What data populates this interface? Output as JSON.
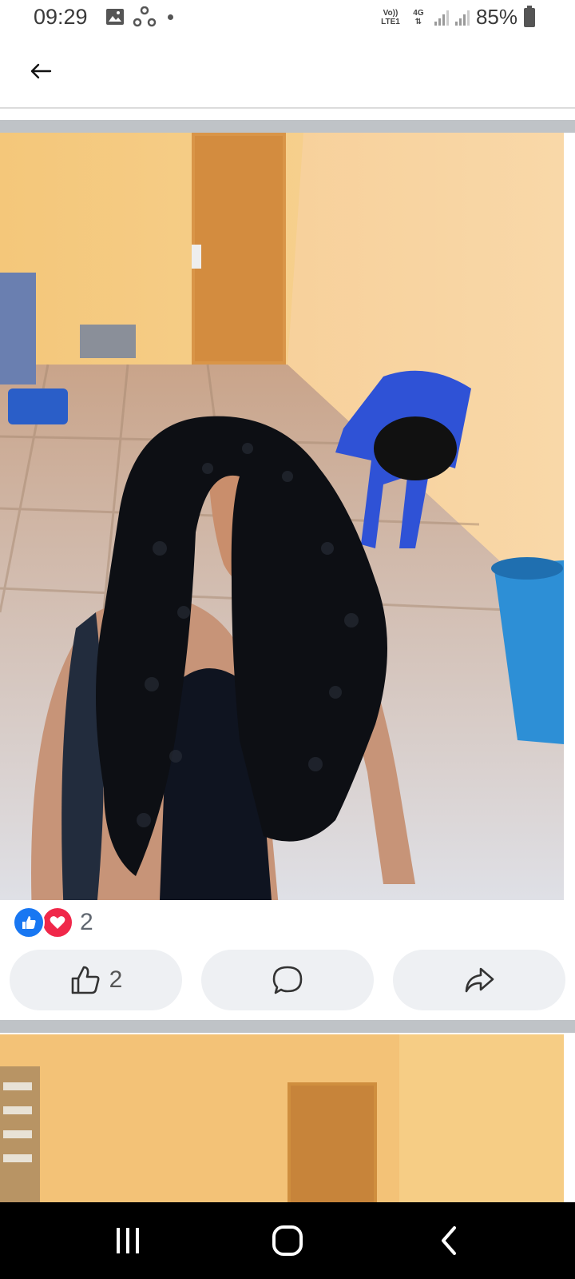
{
  "status_bar": {
    "time": "09:29",
    "network_top": "Vo)) LTE1",
    "network_type": "4G",
    "battery": "85%"
  },
  "header": {
    "back_icon": "arrow-left-icon"
  },
  "post": {
    "reaction_count": "2",
    "like_count": "2",
    "reaction_icons": [
      "like-icon",
      "love-icon"
    ]
  },
  "actions": {
    "like_icon": "thumbs-up-icon",
    "comment_icon": "comment-icon",
    "share_icon": "share-icon"
  },
  "nav": {
    "items": [
      "recent-apps-icon",
      "home-icon",
      "back-icon"
    ]
  },
  "colors": {
    "like_blue": "#1877f2",
    "love_red": "#f0284a",
    "button_bg": "#eef0f3",
    "divider": "#bfc3c7"
  }
}
